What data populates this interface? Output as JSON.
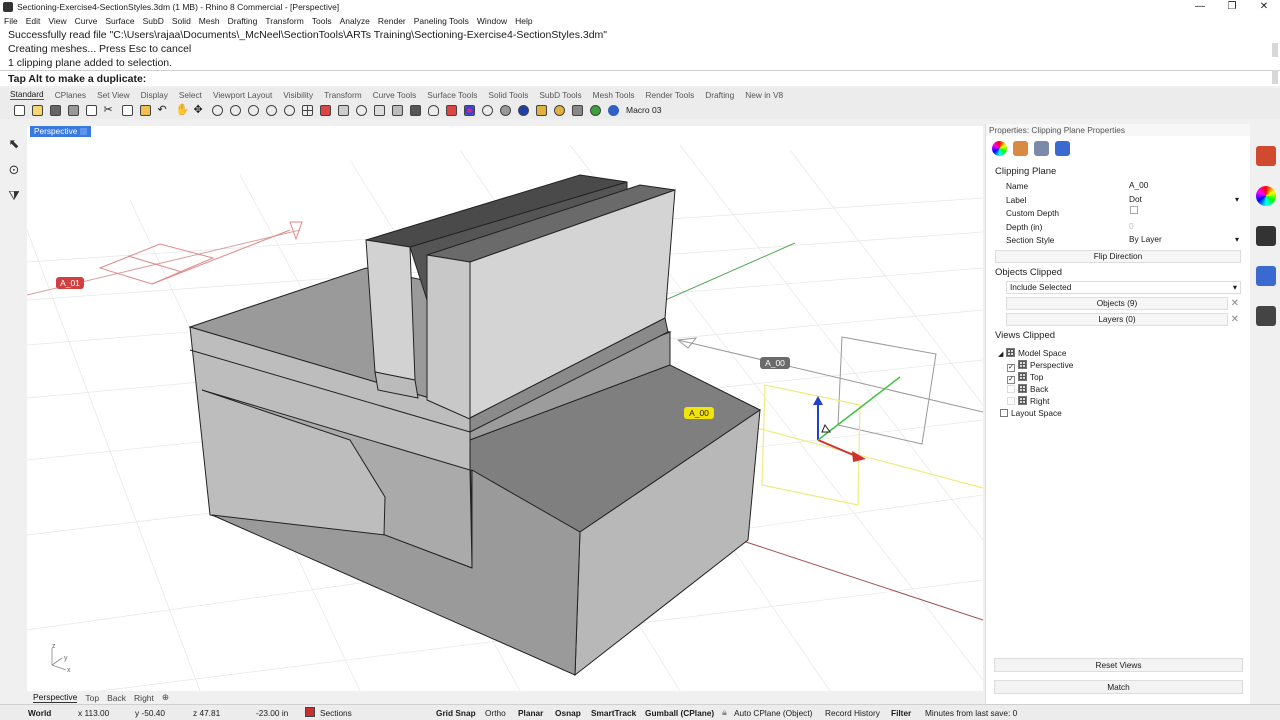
{
  "window": {
    "title": "Sectioning-Exercise4-SectionStyles.3dm (1 MB) - Rhino 8 Commercial - [Perspective]",
    "min": "—",
    "max": "❐",
    "close": "✕"
  },
  "menu": [
    "File",
    "Edit",
    "View",
    "Curve",
    "Surface",
    "SubD",
    "Solid",
    "Mesh",
    "Drafting",
    "Transform",
    "Tools",
    "Analyze",
    "Render",
    "Paneling Tools",
    "Window",
    "Help"
  ],
  "command": {
    "history": [
      "Successfully read file \"C:\\Users\\rajaa\\Documents\\_McNeel\\SectionTools\\ARTs Training\\Sectioning-Exercise4-SectionStyles.3dm\"",
      "Creating meshes... Press Esc to cancel",
      "1 clipping plane added to selection."
    ],
    "prompt": "Tap Alt to make a duplicate:"
  },
  "toolbar_tabs": [
    "Standard",
    "CPlanes",
    "Set View",
    "Display",
    "Select",
    "Viewport Layout",
    "Visibility",
    "Transform",
    "Curve Tools",
    "Surface Tools",
    "Solid Tools",
    "SubD Tools",
    "Mesh Tools",
    "Render Tools",
    "Drafting",
    "New in V8"
  ],
  "toolbar": {
    "macro_label": "Macro 03"
  },
  "viewport": {
    "name": "Perspective",
    "labels": {
      "a01": "A_01",
      "a00_grey": "A_00",
      "a00_yellow": "A_00"
    },
    "axis": {
      "x": "x",
      "y": "y",
      "z": "z"
    }
  },
  "view_tabs": [
    "Perspective",
    "Top",
    "Back",
    "Right",
    "⊕"
  ],
  "status": {
    "world": "World",
    "x": "x 113.00",
    "y": "y -50.40",
    "z": "z 47.81",
    "dist": "-23.00 in",
    "layer": "Sections",
    "layer_color": "#c43030",
    "grid_snap": "Grid Snap",
    "ortho": "Ortho",
    "planar": "Planar",
    "osnap": "Osnap",
    "smarttrack": "SmartTrack",
    "gumball": "Gumball (CPlane)",
    "auto_cplane": "Auto CPlane (Object)",
    "record_history": "Record History",
    "filter": "Filter",
    "last_save": "Minutes from last save: 0"
  },
  "panel": {
    "title": "Properties: Clipping Plane Properties",
    "section_clipping": "Clipping Plane",
    "fields": {
      "name_label": "Name",
      "name_value": "A_00",
      "label_label": "Label",
      "label_value": "Dot",
      "custom_depth_label": "Custom Depth",
      "depth_label": "Depth (in)",
      "depth_value": "0",
      "section_style_label": "Section Style",
      "section_style_value": "By Layer"
    },
    "flip_button": "Flip Direction",
    "section_objects": "Objects Clipped",
    "objects_mode": "Include Selected",
    "objects_button": "Objects (9)",
    "layers_button": "Layers (0)",
    "section_views": "Views Clipped",
    "tree": {
      "model_space": "Model Space",
      "perspective": "Perspective",
      "top": "Top",
      "back": "Back",
      "right": "Right",
      "layout_space": "Layout Space"
    },
    "reset_views": "Reset Views",
    "match": "Match"
  }
}
